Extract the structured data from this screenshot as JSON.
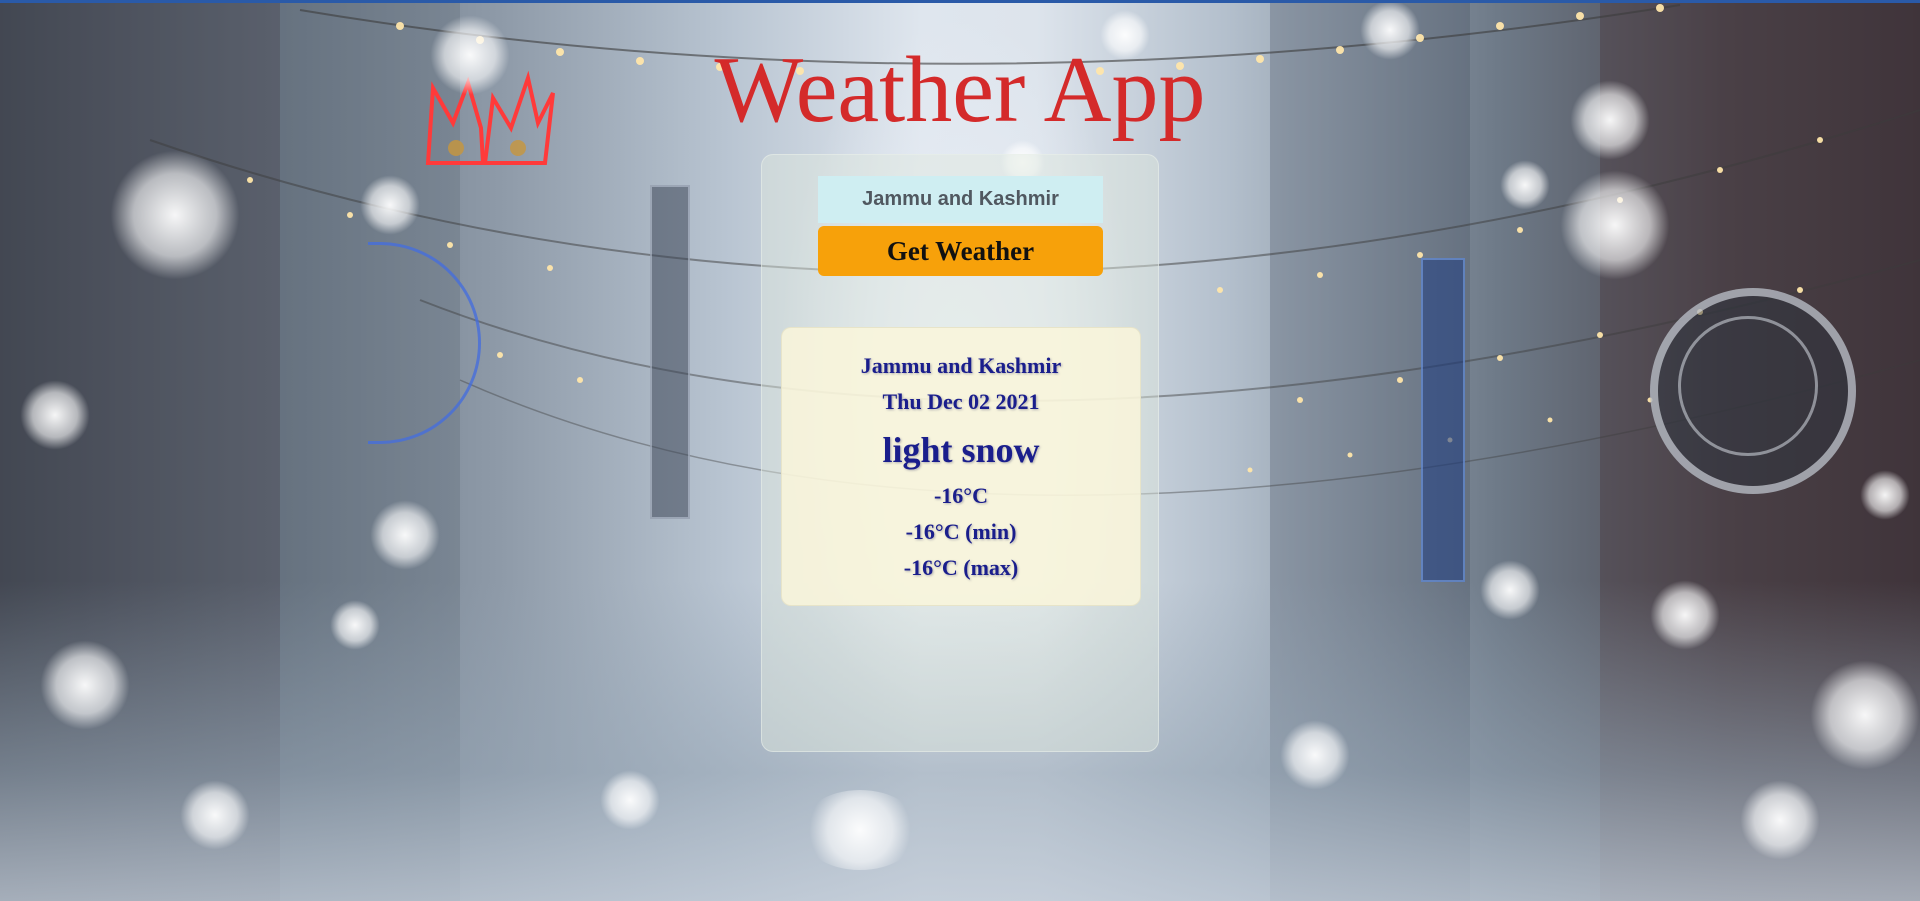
{
  "app": {
    "title": "Weather App"
  },
  "search": {
    "value": "Jammu and Kashmir",
    "button_label": "Get Weather"
  },
  "result": {
    "location": "Jammu and Kashmir",
    "date": "Thu Dec 02 2021",
    "description": "light snow",
    "temperature": "-16°C",
    "temp_min": "-16°C (min)",
    "temp_max": "-16°C (max)"
  },
  "colors": {
    "title": "#d42a2a",
    "button": "#f7a10a",
    "input_bg": "#cfeef2",
    "result_text": "#1a1e8c"
  }
}
